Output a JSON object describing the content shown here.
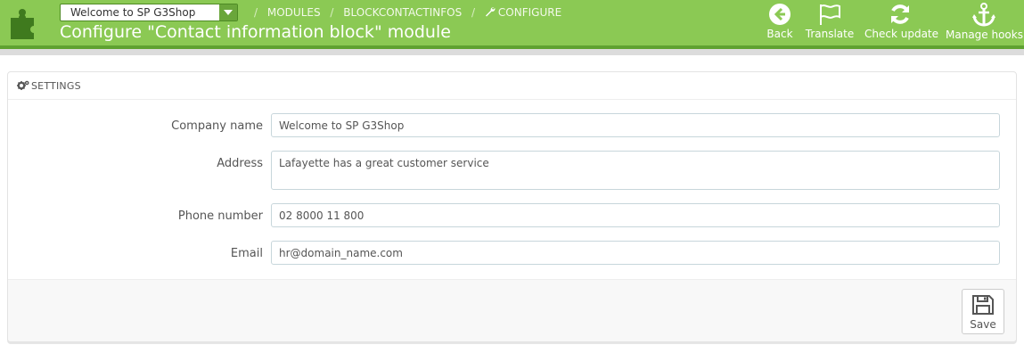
{
  "header": {
    "shop_selector": "Welcome to SP G3Shop",
    "breadcrumb": [
      "MODULES",
      "BLOCKCONTACTINFOS",
      "CONFIGURE"
    ],
    "title": "Configure \"Contact information block\" module",
    "toolbar": [
      {
        "label": "Back",
        "icon": "back-circle-icon"
      },
      {
        "label": "Translate",
        "icon": "flag-icon"
      },
      {
        "label": "Check update",
        "icon": "refresh-icon"
      },
      {
        "label": "Manage hooks",
        "icon": "anchor-icon"
      }
    ]
  },
  "panel": {
    "heading": "SETTINGS",
    "fields": [
      {
        "label": "Company name",
        "value": "Welcome to SP G3Shop"
      },
      {
        "label": "Address",
        "value": "Lafayette has a great customer service"
      },
      {
        "label": "Phone number",
        "value": "02 8000 11 800"
      },
      {
        "label": "Email",
        "value": "hr@domain_name.com"
      }
    ],
    "save_label": "Save"
  },
  "colors": {
    "header_bg": "#8bc954",
    "header_stripe": "#5fa231",
    "module_icon": "#3f7a1e"
  }
}
